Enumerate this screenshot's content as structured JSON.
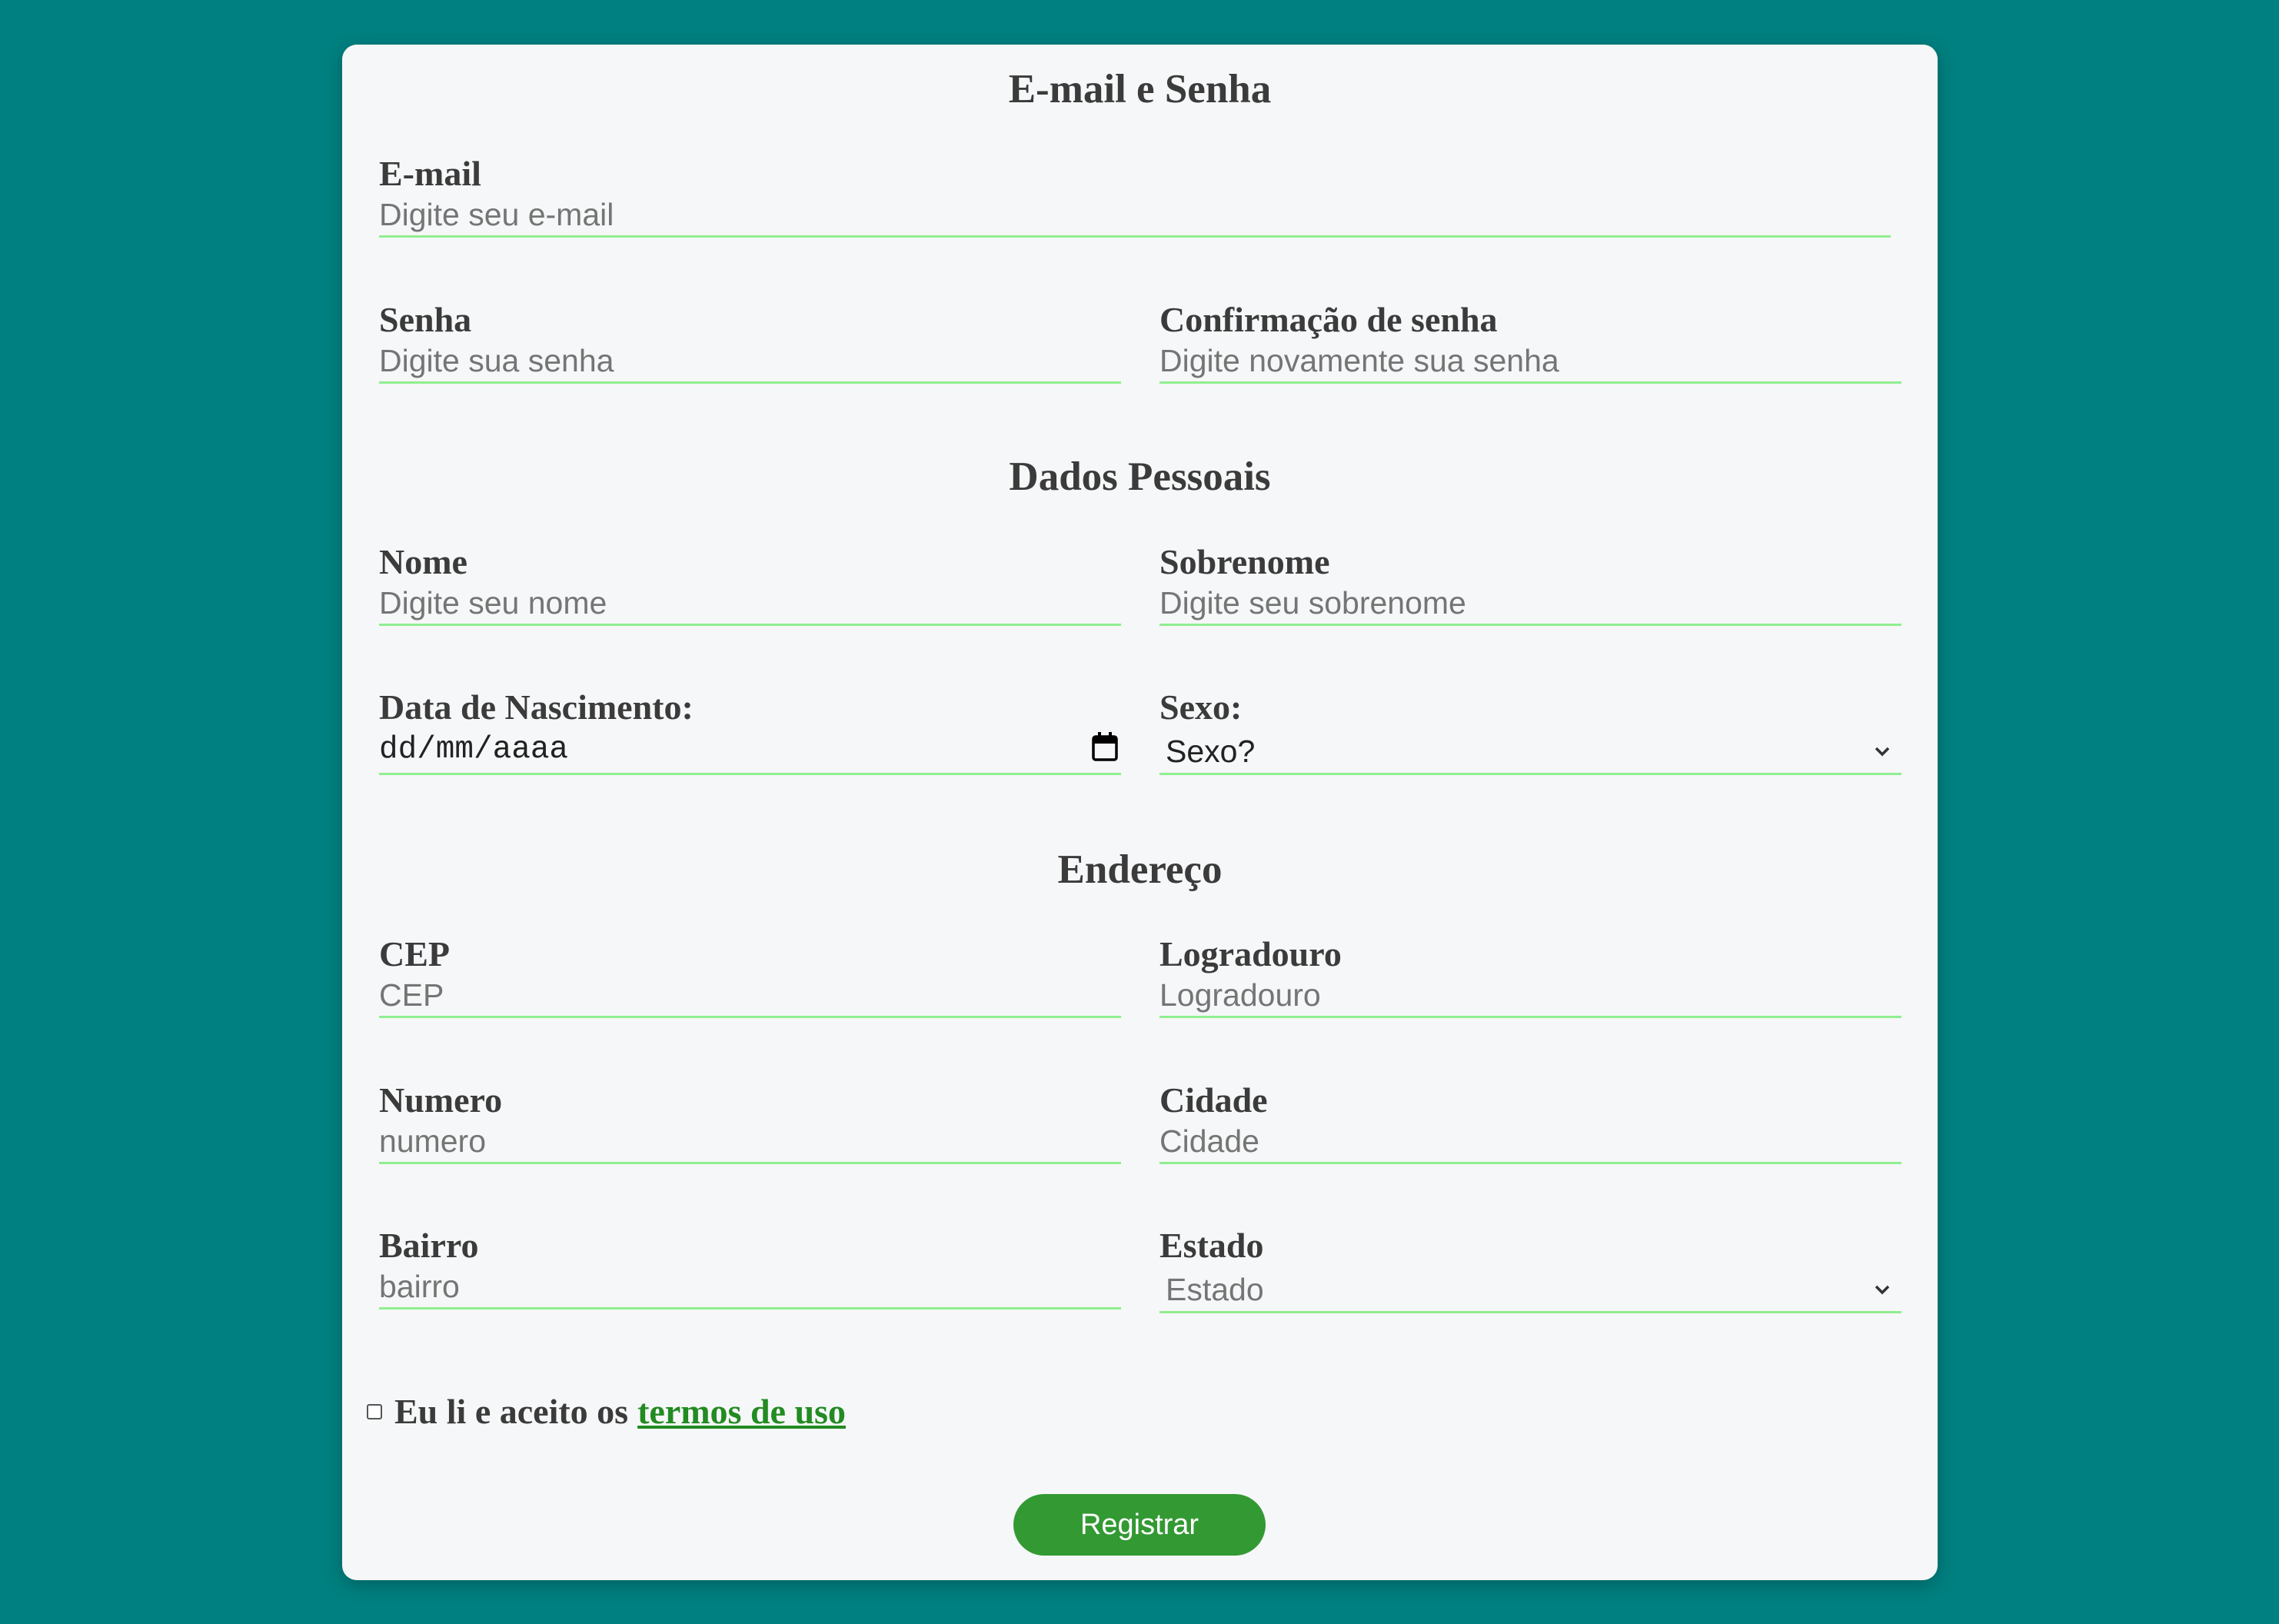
{
  "sections": {
    "credentials_title": "E-mail e Senha",
    "personal_title": "Dados Pessoais",
    "address_title": "Endereço"
  },
  "fields": {
    "email": {
      "label": "E-mail",
      "placeholder": "Digite seu e-mail"
    },
    "password": {
      "label": "Senha",
      "placeholder": "Digite sua senha"
    },
    "password_confirm": {
      "label": "Confirmação de senha",
      "placeholder": "Digite novamente sua senha"
    },
    "first_name": {
      "label": "Nome",
      "placeholder": "Digite seu nome"
    },
    "last_name": {
      "label": "Sobrenome",
      "placeholder": "Digite seu sobrenome"
    },
    "birth_date": {
      "label": "Data de Nascimento:",
      "value": "dd/mm/aaaa"
    },
    "sex": {
      "label": "Sexo:",
      "selected": "Sexo?"
    },
    "cep": {
      "label": "CEP",
      "placeholder": "CEP"
    },
    "street": {
      "label": "Logradouro",
      "placeholder": "Logradouro"
    },
    "number": {
      "label": "Numero",
      "placeholder": "numero"
    },
    "city": {
      "label": "Cidade",
      "placeholder": "Cidade"
    },
    "district": {
      "label": "Bairro",
      "placeholder": "bairro"
    },
    "state": {
      "label": "Estado",
      "selected": "Estado"
    }
  },
  "terms": {
    "text": "Eu li e aceito os",
    "link": "termos de uso",
    "checked": false
  },
  "submit": {
    "label": "Registrar"
  },
  "colors": {
    "background": "#008080",
    "card": "#f6f7f8",
    "input_underline": "#90ee90",
    "button": "#339933",
    "link": "#228b22"
  },
  "icons": {
    "date": "calendar-icon",
    "select": "chevron-down-icon"
  }
}
